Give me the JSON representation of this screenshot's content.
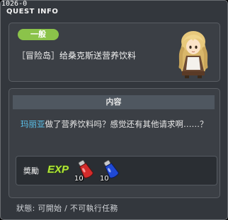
{
  "window": {
    "quest_code": "1026-0",
    "title": "QUEST INFO"
  },
  "quest": {
    "tag": "一般",
    "name": "［冒险岛］给桑克斯送营养饮料"
  },
  "content": {
    "header": "内容",
    "npc_name": "玛丽亚",
    "text": "做了营养饮料吗？感觉还有其他请求啊……？"
  },
  "reward": {
    "label": "奬勵",
    "exp_label": "EXP",
    "items": [
      {
        "name": "red-potion-icon",
        "count": "10",
        "color": "#d32b2b"
      },
      {
        "name": "blue-potion-icon",
        "count": "10",
        "color": "#1f49d6"
      }
    ]
  },
  "status": "狀態: 可開始 / 不可執行任務",
  "colors": {
    "accent_green": "#8bc34a",
    "npc_name_blue": "#5cc6f0",
    "window_bg": "#33373d"
  }
}
